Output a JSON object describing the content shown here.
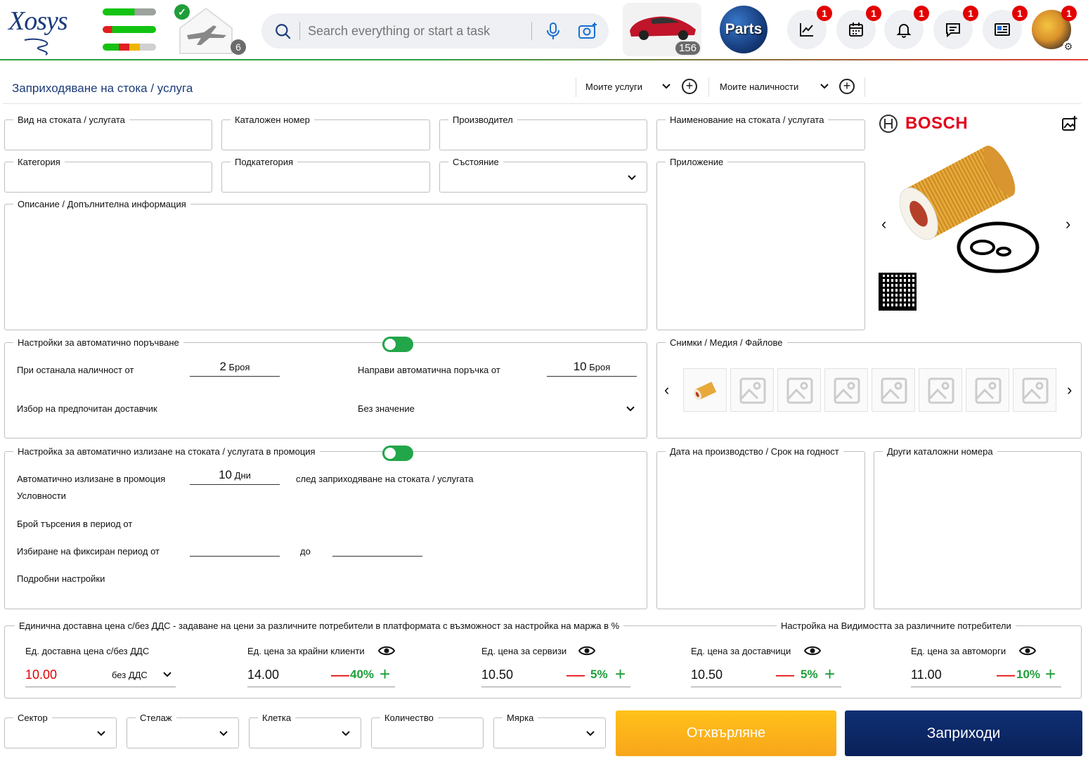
{
  "header": {
    "logo_text": "Xosys",
    "house_count": "6",
    "search_placeholder": "Search everything or start a task",
    "car_count": "156",
    "parts_label": "Parts",
    "badges": {
      "analytics": "1",
      "calendar": "1",
      "notifications": "1",
      "messages": "1",
      "news": "1",
      "avatar": "1"
    },
    "colors": {
      "accent": "#1b3b7a",
      "badge": "#e30000",
      "success": "#1f9e3a"
    }
  },
  "title_bar": {
    "title": "Заприходяване на стока / услуга",
    "my_services": "Моите услуги",
    "my_stock": "Моите наличности"
  },
  "fields": {
    "goods_type": "Вид на стоката / услугата",
    "catalog_number": "Каталожен номер",
    "manufacturer": "Производител",
    "goods_name": "Наименование на стоката / услугата",
    "category": "Категория",
    "subcategory": "Подкатегория",
    "condition": "Състояние",
    "application": "Приложение",
    "description": "Описание / Допълнителна информация"
  },
  "product": {
    "brand": "BOSCH"
  },
  "auto_order": {
    "legend": "Настройки за автоматично поръчване",
    "remaining_label": "При останала наличност от",
    "remaining_value": "2",
    "remaining_unit": "Броя",
    "order_label": "Направи автоматична поръчка от",
    "order_value": "10",
    "order_unit": "Броя",
    "supplier_label": "Избор на предпочитан доставчик",
    "supplier_value": "Без значение"
  },
  "media": {
    "legend": "Снимки / Медия / Файлове"
  },
  "promo": {
    "legend": "Настройка за автоматично излизане на стоката / услугата в промоция",
    "auto_label": "Автоматично излизане в промоция",
    "auto_value": "10",
    "auto_unit": "Дни",
    "after_text": "след заприходяване на стоката / услугата",
    "conditions": "Условности",
    "searches_label": "Брой търсения в период от",
    "fixed_label": "Избиране на фиксиран период от",
    "to_label": "до",
    "details": "Подробни настройки"
  },
  "dates": {
    "production_legend": "Дата на производство / Срок на годност",
    "other_catalog_legend": "Други каталожни номера"
  },
  "pricing": {
    "legend": "Единична доставна цена с/без ДДС -  задаване на цени за различните потребители в платформата с възможност за настройка на маржа в %",
    "visibility_legend": "Настройка на Видимостта за различните потребители",
    "delivery_label": "Ед. доставна цена с/без ДДС",
    "delivery_value": "10.00",
    "vat_option": "без ДДС",
    "end_clients_label": "Ед. цена за крайни клиенти",
    "end_clients_value": "14.00",
    "end_clients_pct": "40%",
    "services_label": "Ед. цена за сервизи",
    "services_value": "10.50",
    "services_pct": "5%",
    "suppliers_label": "Ед. цена за доставчици",
    "suppliers_value": "10.50",
    "suppliers_pct": "5%",
    "dealers_label": "Ед. цена за автоморги",
    "dealers_value": "11.00",
    "dealers_pct": "10%"
  },
  "storage": {
    "sector": "Сектор",
    "rack": "Стелаж",
    "cell": "Клетка",
    "quantity": "Количество",
    "unit": "Мярка"
  },
  "actions": {
    "reject": "Отхвърляне",
    "submit": "Заприходи"
  }
}
